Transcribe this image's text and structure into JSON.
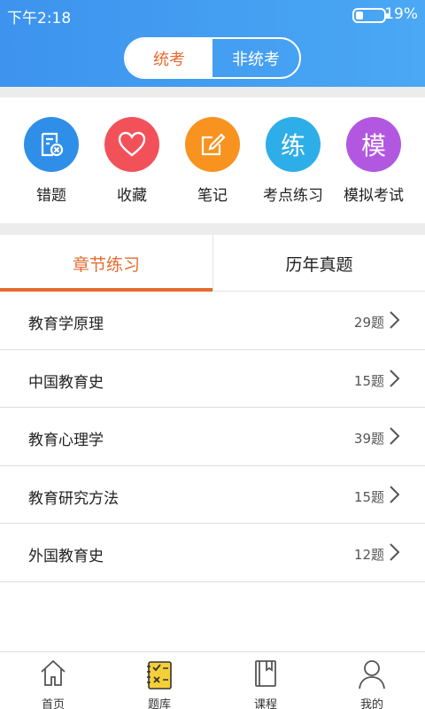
{
  "status": {
    "time": "下午2:18",
    "battery_pct": "19%",
    "battery_level": 0.19
  },
  "segment": {
    "active": "统考",
    "inactive": "非统考"
  },
  "shortcuts": [
    {
      "label": "错题",
      "icon": "wrong-question-icon",
      "color": "#2f8fe8",
      "glyph": ""
    },
    {
      "label": "收藏",
      "icon": "heart-icon",
      "color": "#f2515a",
      "glyph": ""
    },
    {
      "label": "笔记",
      "icon": "edit-note-icon",
      "color": "#f7931e",
      "glyph": ""
    },
    {
      "label": "考点练习",
      "icon": "practice-icon",
      "color": "#2eaee8",
      "glyph": "练"
    },
    {
      "label": "模拟考试",
      "icon": "mock-exam-icon",
      "color": "#b258e0",
      "glyph": "模"
    }
  ],
  "tabs": {
    "active": "章节练习",
    "inactive": "历年真题",
    "accent": "#e56b2f"
  },
  "chapters": [
    {
      "name": "教育学原理",
      "count": "29题"
    },
    {
      "name": "中国教育史",
      "count": "15题"
    },
    {
      "name": "教育心理学",
      "count": "39题"
    },
    {
      "name": "教育研究方法",
      "count": "15题"
    },
    {
      "name": "外国教育史",
      "count": "12题"
    }
  ],
  "bottom_nav": [
    {
      "label": "首页",
      "icon": "home-icon"
    },
    {
      "label": "题库",
      "icon": "question-bank-icon"
    },
    {
      "label": "课程",
      "icon": "course-book-icon"
    },
    {
      "label": "我的",
      "icon": "profile-icon"
    }
  ]
}
